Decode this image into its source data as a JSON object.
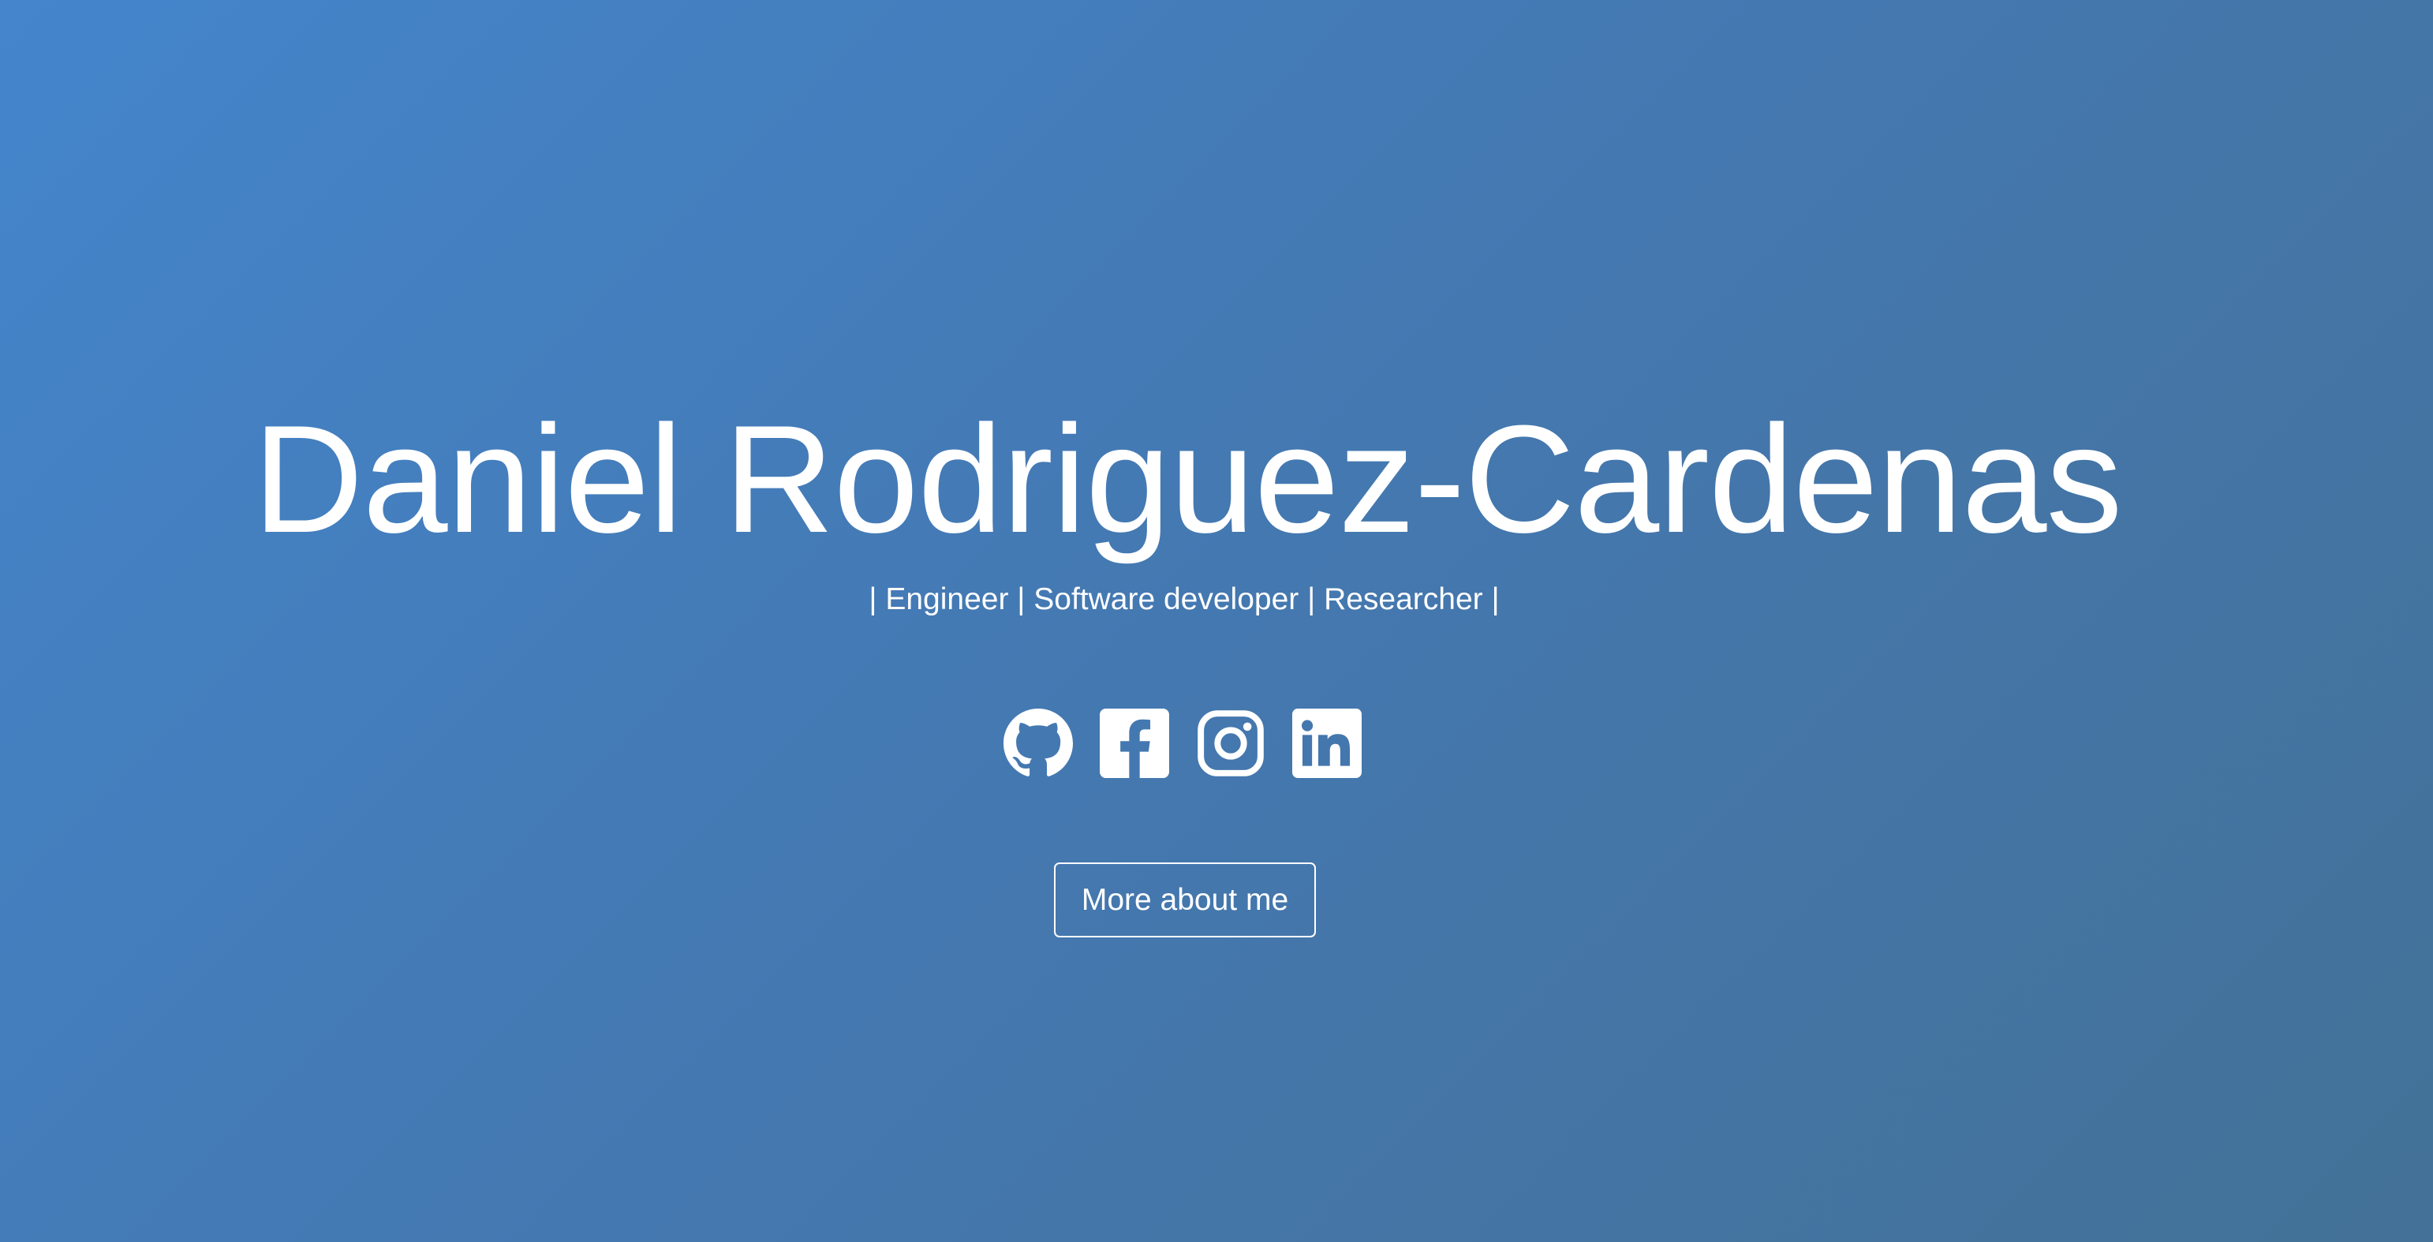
{
  "hero": {
    "name": "Daniel Rodriguez-Cardenas",
    "tagline": "| Engineer | Software developer | Researcher |",
    "socials": [
      {
        "icon": "github-icon"
      },
      {
        "icon": "facebook-icon"
      },
      {
        "icon": "instagram-icon"
      },
      {
        "icon": "linkedin-icon"
      }
    ],
    "more_button_label": "More about me"
  },
  "colors": {
    "background_start": "#4485cc",
    "background_end": "#437197",
    "foreground": "#ffffff"
  }
}
